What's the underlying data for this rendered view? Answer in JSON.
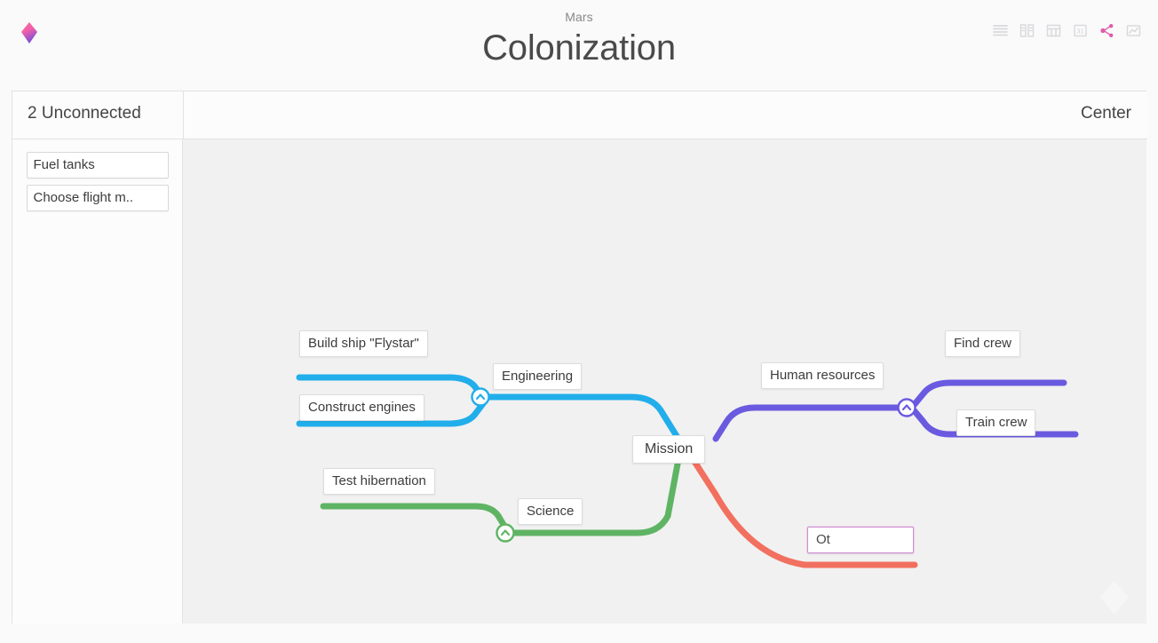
{
  "header": {
    "subtitle": "Mars",
    "title": "Colonization",
    "logo_icon": "diamond-logo-icon",
    "toolbar": [
      {
        "name": "list-view-icon",
        "label": "List view",
        "active": false
      },
      {
        "name": "board-view-icon",
        "label": "Board view",
        "active": false
      },
      {
        "name": "table-view-icon",
        "label": "Table view",
        "active": false
      },
      {
        "name": "calendar-view-icon",
        "label": "31",
        "active": false
      },
      {
        "name": "graph-view-icon",
        "label": "Graph view",
        "active": true
      },
      {
        "name": "chart-view-icon",
        "label": "Chart view",
        "active": false
      }
    ]
  },
  "panel": {
    "unconnected_label": "2 Unconnected",
    "center_label": "Center",
    "unconnected_cards": [
      {
        "label": "Fuel tanks"
      },
      {
        "label": "Choose flight m.."
      }
    ]
  },
  "colors": {
    "blue": "#21AEEB",
    "purple": "#6A5AE0",
    "green": "#5FB464",
    "red": "#F2705F",
    "accent_pink": "#E0569E",
    "canvas_bg": "#f1f1f1",
    "panel_bg": "#fcfcfc",
    "border": "#e2e2e2",
    "editing_border": "#d18ed0"
  },
  "mindmap": {
    "center": {
      "id": "mission",
      "label": "Mission"
    },
    "branches": [
      {
        "id": "engineering",
        "label": "Engineering",
        "color": "#21AEEB",
        "side": "left",
        "collapsed": false,
        "children": [
          {
            "id": "build-ship",
            "label": "Build ship \"Flystar\""
          },
          {
            "id": "construct-engines",
            "label": "Construct engines"
          }
        ]
      },
      {
        "id": "human-resources",
        "label": "Human resources",
        "color": "#6A5AE0",
        "side": "right",
        "collapsed": false,
        "children": [
          {
            "id": "find-crew",
            "label": "Find crew"
          },
          {
            "id": "train-crew",
            "label": "Train crew"
          }
        ]
      },
      {
        "id": "science",
        "label": "Science",
        "color": "#5FB464",
        "side": "left",
        "collapsed": false,
        "children": [
          {
            "id": "test-hibernation",
            "label": "Test hibernation"
          }
        ]
      },
      {
        "id": "other",
        "label": "Ot",
        "color": "#F2705F",
        "side": "right",
        "editing": true,
        "children": []
      }
    ]
  }
}
